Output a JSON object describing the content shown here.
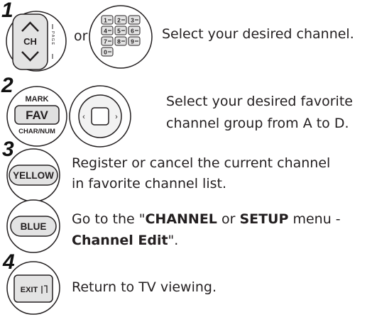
{
  "steps": [
    {
      "number": "1",
      "connector": "or",
      "buttons": {
        "ch_label": "CH",
        "page_label": "P A G E"
      },
      "keypad": {
        "keys": [
          "1",
          "2",
          "3",
          "4",
          "5",
          "6",
          "7",
          "8",
          "9",
          "0"
        ]
      },
      "text": "Select your desired channel."
    },
    {
      "number": "2",
      "buttons": {
        "mark_label": "MARK",
        "fav_label": "FAV",
        "charnum_label": "CHAR/NUM"
      },
      "text_line1": "Select your desired favorite",
      "text_line2": "channel group from A to D."
    },
    {
      "number": "3",
      "button_label": "YELLOW",
      "text_line1": "Register or cancel the current channel",
      "text_line2": "in favorite channel list."
    },
    {
      "button_label": "BLUE",
      "text_prefix": "Go to the \"",
      "bold1": "CHANNEL",
      "mid1": " or ",
      "bold2": "SETUP",
      "mid2": " menu -",
      "bold3": "Channel Edit",
      "suffix": "\"."
    },
    {
      "number": "4",
      "button_label": "EXIT",
      "text": "Return to TV viewing."
    }
  ]
}
